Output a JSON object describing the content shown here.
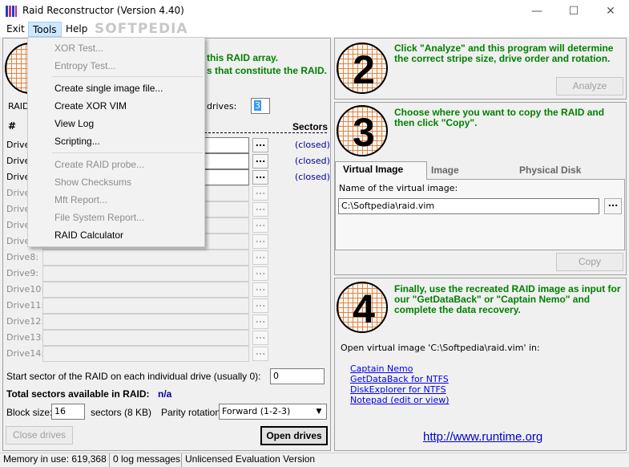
{
  "window": {
    "title": "Raid Reconstructor (Version 4.40)",
    "minimize": "—",
    "maximize": "☐",
    "close": "✕"
  },
  "menubar": {
    "exit": "Exit",
    "tools": "Tools",
    "help": "Help",
    "watermark": "SOFTPEDIA"
  },
  "tools_menu": {
    "items": [
      {
        "label": "XOR Test...",
        "enabled": false
      },
      {
        "label": "Entropy Test...",
        "enabled": false
      },
      {
        "label": "Create single image file...",
        "enabled": true
      },
      {
        "label": "Create XOR VIM",
        "enabled": true
      },
      {
        "label": "View Log",
        "enabled": true
      },
      {
        "label": "Scripting...",
        "enabled": true
      },
      {
        "label": "Create RAID probe...",
        "enabled": false
      },
      {
        "label": "Show Checksums",
        "enabled": false
      },
      {
        "label": "Mft Report...",
        "enabled": false
      },
      {
        "label": "File System Report...",
        "enabled": false
      },
      {
        "label": "RAID Calculator",
        "enabled": true
      }
    ]
  },
  "step1": {
    "text_line1": "this RAID array.",
    "text_line2": "s that constitute the RAID.",
    "raid_label": "RAID",
    "drives_label": "drives:",
    "drives_value": "3",
    "col_hash": "#",
    "col_sectors": "Sectors",
    "drives": [
      {
        "label": "Drive",
        "status": "(closed)",
        "enabled": true
      },
      {
        "label": "Drive",
        "status": "(closed)",
        "enabled": true
      },
      {
        "label": "Drive",
        "status": "(closed)",
        "enabled": true
      },
      {
        "label": "Drive",
        "status": "",
        "enabled": false
      },
      {
        "label": "Drive",
        "status": "",
        "enabled": false
      },
      {
        "label": "Drive",
        "status": "",
        "enabled": false
      },
      {
        "label": "Drive",
        "status": "",
        "enabled": false
      },
      {
        "label": "Drive8:",
        "status": "",
        "enabled": false
      },
      {
        "label": "Drive9:",
        "status": "",
        "enabled": false
      },
      {
        "label": "Drive10:",
        "status": "",
        "enabled": false
      },
      {
        "label": "Drive11:",
        "status": "",
        "enabled": false
      },
      {
        "label": "Drive12:",
        "status": "",
        "enabled": false
      },
      {
        "label": "Drive13:",
        "status": "",
        "enabled": false
      },
      {
        "label": "Drive14:",
        "status": "",
        "enabled": false
      }
    ],
    "browse": "...",
    "start_sector_label": "Start sector of the RAID on each individual drive (usually 0):",
    "start_sector_value": "0",
    "total_label": "Total sectors available in RAID:",
    "total_value": "n/a",
    "block_size_label": "Block size:",
    "block_size_value": "16",
    "block_size_unit": "sectors (8 KB)",
    "parity_label": "Parity rotation:",
    "parity_value": "Forward (1-2-3)",
    "close_drives": "Close drives",
    "open_drives": "Open drives"
  },
  "step2": {
    "number": "2",
    "text": "Click \"Analyze\" and this program will determine the correct stripe size, drive order and rotation.",
    "analyze": "Analyze"
  },
  "step3": {
    "number": "3",
    "text": "Choose where you want to copy the RAID and then click \"Copy\".",
    "tabs": [
      "Virtual Image",
      "Image",
      "Physical Disk"
    ],
    "name_label": "Name of the virtual image:",
    "name_value": "C:\\Softpedia\\raid.vim",
    "browse": "...",
    "copy": "Copy"
  },
  "step4": {
    "number": "4",
    "text": "Finally, use the recreated RAID image as input for our \"GetDataBack\" or \"Captain Nemo\" and complete the data recovery.",
    "open_label": "Open virtual image 'C:\\Softpedia\\raid.vim' in:",
    "links": [
      "Captain Nemo",
      "GetDataBack for NTFS",
      "DiskExplorer for NTFS",
      "Notepad (edit or view)"
    ],
    "url": "http://www.runtime.org"
  },
  "statusbar": {
    "memory": "Memory in use: 619,368",
    "log": "0 log messages",
    "license": "Unlicensed Evaluation Version"
  }
}
